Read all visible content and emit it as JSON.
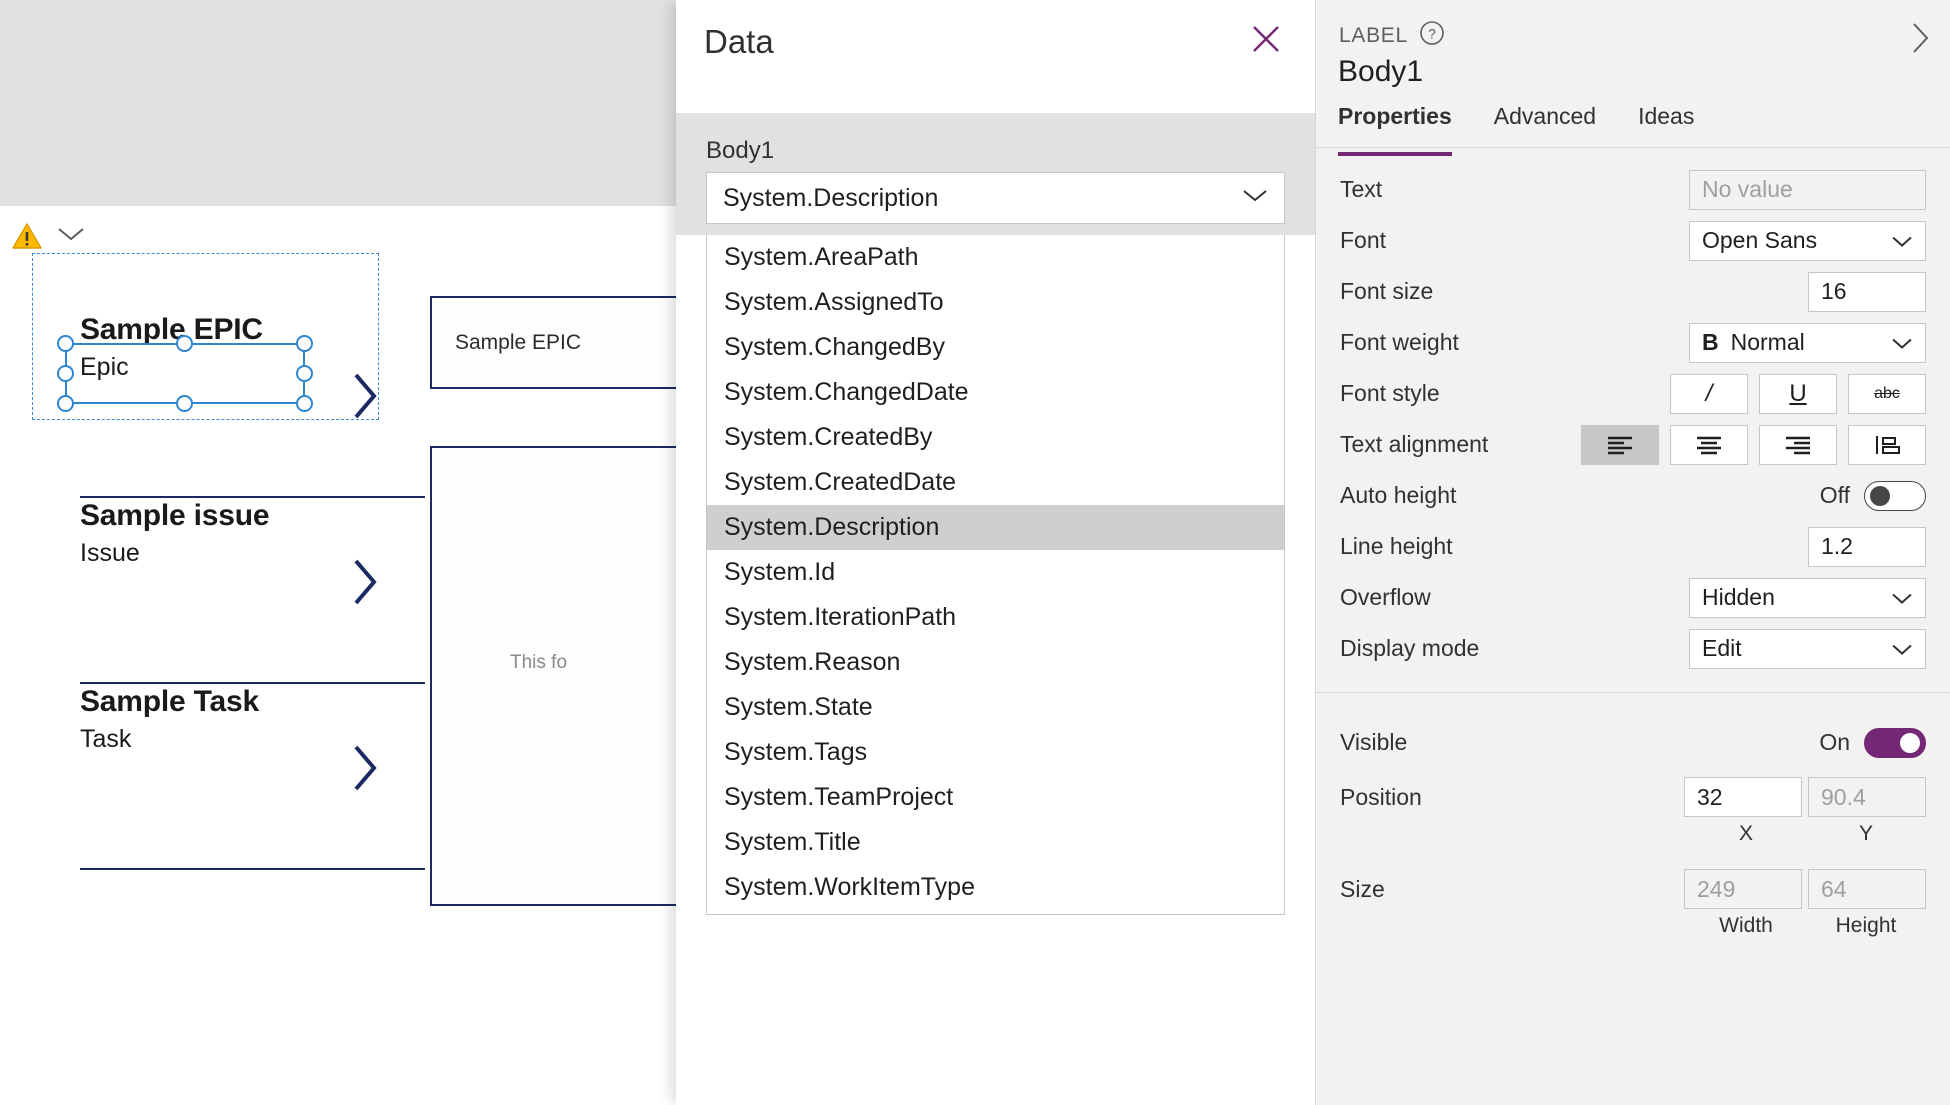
{
  "canvas": {
    "warning_icon": "warning-triangle-icon",
    "collapse_icon": "chevron-down-icon",
    "gallery": [
      {
        "title": "Sample EPIC",
        "subtitle": "Epic",
        "chevron": "chevron-right-icon"
      },
      {
        "title": "Sample issue",
        "subtitle": "Issue",
        "chevron": "chevron-right-icon"
      },
      {
        "title": "Sample Task",
        "subtitle": "Task",
        "chevron": "chevron-right-icon"
      }
    ],
    "form_preview": {
      "title_field": "Sample EPIC",
      "body_hint": "This fo"
    }
  },
  "data_panel": {
    "title": "Data",
    "close_icon": "close-icon",
    "section_label": "Body1",
    "selected_value": "System.Description",
    "dropdown_icon": "chevron-down-icon",
    "options": [
      "System.AreaPath",
      "System.AssignedTo",
      "System.ChangedBy",
      "System.ChangedDate",
      "System.CreatedBy",
      "System.CreatedDate",
      "System.Description",
      "System.Id",
      "System.IterationPath",
      "System.Reason",
      "System.State",
      "System.Tags",
      "System.TeamProject",
      "System.Title",
      "System.WorkItemType"
    ],
    "selected_index": 6
  },
  "properties": {
    "kicker": "LABEL",
    "help_icon": "help-circle-icon",
    "expand_icon": "chevron-right-icon",
    "control_name": "Body1",
    "tabs": [
      {
        "label": "Properties",
        "active": true
      },
      {
        "label": "Advanced",
        "active": false
      },
      {
        "label": "Ideas",
        "active": false
      }
    ],
    "rows": {
      "text": {
        "label": "Text",
        "value": "No value"
      },
      "font": {
        "label": "Font",
        "value": "Open Sans"
      },
      "font_size": {
        "label": "Font size",
        "value": "16"
      },
      "font_weight": {
        "label": "Font weight",
        "value": "Normal",
        "bold_glyph": "B"
      },
      "font_style": {
        "label": "Font style",
        "buttons": [
          {
            "name": "italic-icon",
            "glyph": "/"
          },
          {
            "name": "underline-icon",
            "glyph": "U"
          },
          {
            "name": "strikethrough-icon",
            "glyph": "abc"
          }
        ]
      },
      "text_alignment": {
        "label": "Text alignment",
        "buttons": [
          {
            "name": "align-left-icon",
            "selected": true
          },
          {
            "name": "align-center-icon",
            "selected": false
          },
          {
            "name": "align-right-icon",
            "selected": false
          },
          {
            "name": "align-justify-icon",
            "selected": false
          }
        ]
      },
      "auto_height": {
        "label": "Auto height",
        "state": "Off",
        "on": false
      },
      "line_height": {
        "label": "Line height",
        "value": "1.2"
      },
      "overflow": {
        "label": "Overflow",
        "value": "Hidden"
      },
      "display_mode": {
        "label": "Display mode",
        "value": "Edit"
      },
      "visible": {
        "label": "Visible",
        "state": "On",
        "on": true
      },
      "position": {
        "label": "Position",
        "x": "32",
        "y": "90.4",
        "x_label": "X",
        "y_label": "Y"
      },
      "size": {
        "label": "Size",
        "width": "249",
        "height": "64",
        "width_label": "Width",
        "height_label": "Height"
      }
    }
  },
  "colors": {
    "accent_purple": "#742774",
    "selection_blue": "#2e86d0",
    "app_navy": "#1b2a63",
    "panel_bg": "#f3f2f1",
    "subhead_gray": "#e1e1e1"
  }
}
